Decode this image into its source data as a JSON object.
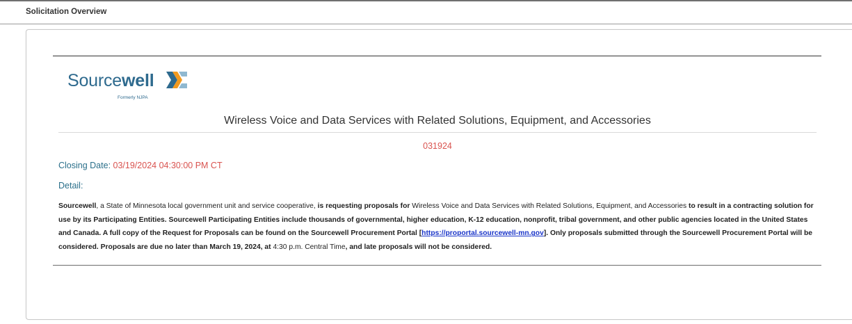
{
  "header": {
    "title": "Solicitation Overview"
  },
  "logo": {
    "word_light": "Source",
    "word_bold": "well",
    "subtitle": "Formerly NJPA"
  },
  "solicitation": {
    "title": "Wireless Voice and Data Services with Related Solutions, Equipment, and Accessories",
    "number": "031924",
    "closing_label": "Closing Date:",
    "closing_value": "03/19/2024 04:30:00 PM CT",
    "detail_label": "Detail:"
  },
  "detail": {
    "p1": "Sourcewell",
    "p2": ", a State of Minnesota local government unit and service cooperative, ",
    "p3": "is requesting proposals for",
    "p4": " Wireless Voice and Data Services with Related Solutions, Equipment, and Accessories ",
    "p5": "to result in a contracting solution for use by its Participating Entities. Sourcewell Participating Entities include thousands of governmental, higher education, K-12 education, nonprofit, tribal government, and other public agencies located in the United States and Canada. A full copy of the Request for Proposals can be found on the Sourcewell Procurement Portal [",
    "link": "https://proportal.sourcewell-mn.gov",
    "p6": "]. Only proposals submitted through the Sourcewell Procurement Portal will be considered. Proposals are due no later than March 19, 2024, at ",
    "p7": "4:30 p.m. Central Time",
    "p8": ", and late proposals will not be considered."
  },
  "colors": {
    "accent_teal": "#2a6f8a",
    "alert_red": "#d9534f",
    "link_blue": "#1a35c9",
    "logo_blue": "#2e6a8e"
  }
}
